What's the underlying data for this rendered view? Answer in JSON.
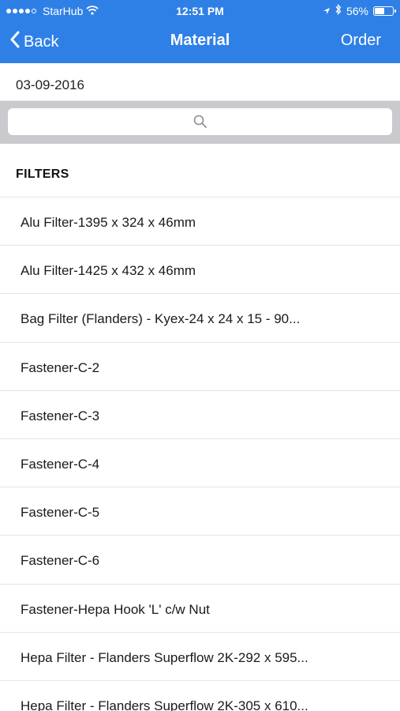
{
  "status_bar": {
    "carrier": "StarHub",
    "time": "12:51 PM",
    "battery_percent": "56%",
    "battery_level": 0.56
  },
  "nav": {
    "back_label": "Back",
    "title": "Material",
    "order_label": "Order"
  },
  "date": "03-09-2016",
  "search": {
    "placeholder": ""
  },
  "section": {
    "title": "FILTERS"
  },
  "items": [
    {
      "label": "Alu Filter-1395 x 324 x 46mm"
    },
    {
      "label": "Alu Filter-1425 x 432 x 46mm"
    },
    {
      "label": "Bag Filter (Flanders) - Kyex-24 x 24  x 15 - 90..."
    },
    {
      "label": "Fastener-C-2"
    },
    {
      "label": "Fastener-C-3"
    },
    {
      "label": "Fastener-C-4"
    },
    {
      "label": "Fastener-C-5"
    },
    {
      "label": "Fastener-C-6"
    },
    {
      "label": "Fastener-Hepa Hook 'L' c/w Nut"
    },
    {
      "label": "Hepa Filter - Flanders Superflow 2K-292 x 595..."
    },
    {
      "label": "Hepa Filter - Flanders Superflow 2K-305 x 610..."
    }
  ],
  "colors": {
    "accent": "#2f80e6",
    "search_background": "#c9c9ce"
  },
  "icons": {
    "back": "chevron-left-icon",
    "search": "search-icon",
    "wifi": "wifi-icon",
    "location": "location-arrow-icon",
    "bluetooth": "bluetooth-icon",
    "battery": "battery-icon"
  }
}
